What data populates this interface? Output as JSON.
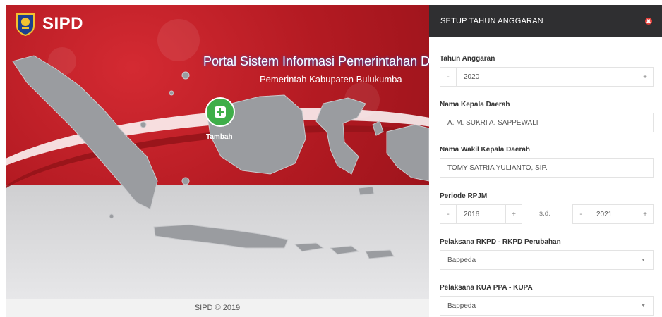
{
  "brand": {
    "name": "SIPD"
  },
  "hero": {
    "title": "Portal Sistem Informasi Pemerintahan D",
    "subtitle": "Pemerintah Kabupaten Bulukumba",
    "add_label": "Tambah"
  },
  "footer": {
    "text": "SIPD © 2019"
  },
  "panel": {
    "title": "SETUP TAHUN ANGGARAN",
    "tahun": {
      "label": "Tahun Anggaran",
      "minus": "-",
      "value": "2020",
      "plus": "+"
    },
    "kepala": {
      "label": "Nama Kepala Daerah",
      "value": "A. M. SUKRI A. SAPPEWALI"
    },
    "wakil": {
      "label": "Nama Wakil Kepala Daerah",
      "value": "TOMY SATRIA YULIANTO, SIP."
    },
    "periode": {
      "label": "Periode RPJM",
      "start": {
        "minus": "-",
        "value": "2016",
        "plus": "+"
      },
      "separator": "s.d.",
      "end": {
        "minus": "-",
        "value": "2021",
        "plus": "+"
      }
    },
    "rkpd": {
      "label": "Pelaksana RKPD - RKPD Perubahan",
      "value": "Bappeda"
    },
    "kua": {
      "label": "Pelaksana KUA PPA - KUPA",
      "value": "Bappeda"
    }
  },
  "colors": {
    "hero_red": "#b31a22",
    "panel_header": "#2f2f31",
    "add_button": "#3fae49",
    "close": "#e8413b"
  }
}
